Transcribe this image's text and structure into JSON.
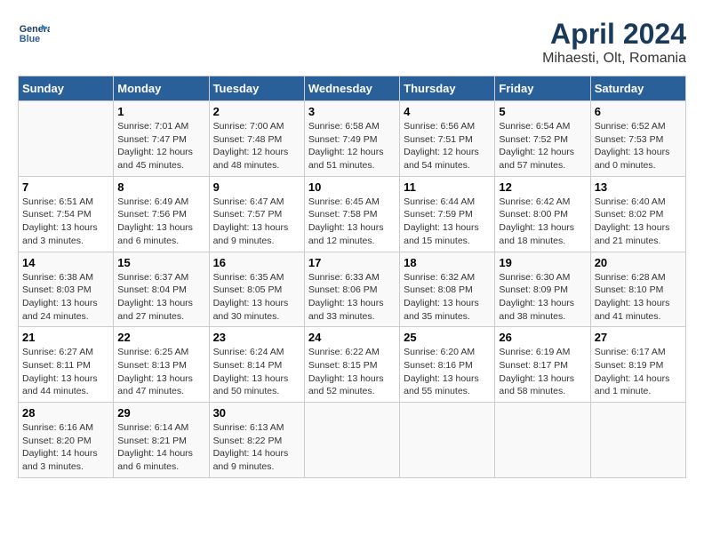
{
  "header": {
    "logo_line1": "General",
    "logo_line2": "Blue",
    "title": "April 2024",
    "subtitle": "Mihaesti, Olt, Romania"
  },
  "days_of_week": [
    "Sunday",
    "Monday",
    "Tuesday",
    "Wednesday",
    "Thursday",
    "Friday",
    "Saturday"
  ],
  "weeks": [
    [
      {
        "day": "",
        "info": ""
      },
      {
        "day": "1",
        "info": "Sunrise: 7:01 AM\nSunset: 7:47 PM\nDaylight: 12 hours\nand 45 minutes."
      },
      {
        "day": "2",
        "info": "Sunrise: 7:00 AM\nSunset: 7:48 PM\nDaylight: 12 hours\nand 48 minutes."
      },
      {
        "day": "3",
        "info": "Sunrise: 6:58 AM\nSunset: 7:49 PM\nDaylight: 12 hours\nand 51 minutes."
      },
      {
        "day": "4",
        "info": "Sunrise: 6:56 AM\nSunset: 7:51 PM\nDaylight: 12 hours\nand 54 minutes."
      },
      {
        "day": "5",
        "info": "Sunrise: 6:54 AM\nSunset: 7:52 PM\nDaylight: 12 hours\nand 57 minutes."
      },
      {
        "day": "6",
        "info": "Sunrise: 6:52 AM\nSunset: 7:53 PM\nDaylight: 13 hours\nand 0 minutes."
      }
    ],
    [
      {
        "day": "7",
        "info": "Sunrise: 6:51 AM\nSunset: 7:54 PM\nDaylight: 13 hours\nand 3 minutes."
      },
      {
        "day": "8",
        "info": "Sunrise: 6:49 AM\nSunset: 7:56 PM\nDaylight: 13 hours\nand 6 minutes."
      },
      {
        "day": "9",
        "info": "Sunrise: 6:47 AM\nSunset: 7:57 PM\nDaylight: 13 hours\nand 9 minutes."
      },
      {
        "day": "10",
        "info": "Sunrise: 6:45 AM\nSunset: 7:58 PM\nDaylight: 13 hours\nand 12 minutes."
      },
      {
        "day": "11",
        "info": "Sunrise: 6:44 AM\nSunset: 7:59 PM\nDaylight: 13 hours\nand 15 minutes."
      },
      {
        "day": "12",
        "info": "Sunrise: 6:42 AM\nSunset: 8:00 PM\nDaylight: 13 hours\nand 18 minutes."
      },
      {
        "day": "13",
        "info": "Sunrise: 6:40 AM\nSunset: 8:02 PM\nDaylight: 13 hours\nand 21 minutes."
      }
    ],
    [
      {
        "day": "14",
        "info": "Sunrise: 6:38 AM\nSunset: 8:03 PM\nDaylight: 13 hours\nand 24 minutes."
      },
      {
        "day": "15",
        "info": "Sunrise: 6:37 AM\nSunset: 8:04 PM\nDaylight: 13 hours\nand 27 minutes."
      },
      {
        "day": "16",
        "info": "Sunrise: 6:35 AM\nSunset: 8:05 PM\nDaylight: 13 hours\nand 30 minutes."
      },
      {
        "day": "17",
        "info": "Sunrise: 6:33 AM\nSunset: 8:06 PM\nDaylight: 13 hours\nand 33 minutes."
      },
      {
        "day": "18",
        "info": "Sunrise: 6:32 AM\nSunset: 8:08 PM\nDaylight: 13 hours\nand 35 minutes."
      },
      {
        "day": "19",
        "info": "Sunrise: 6:30 AM\nSunset: 8:09 PM\nDaylight: 13 hours\nand 38 minutes."
      },
      {
        "day": "20",
        "info": "Sunrise: 6:28 AM\nSunset: 8:10 PM\nDaylight: 13 hours\nand 41 minutes."
      }
    ],
    [
      {
        "day": "21",
        "info": "Sunrise: 6:27 AM\nSunset: 8:11 PM\nDaylight: 13 hours\nand 44 minutes."
      },
      {
        "day": "22",
        "info": "Sunrise: 6:25 AM\nSunset: 8:13 PM\nDaylight: 13 hours\nand 47 minutes."
      },
      {
        "day": "23",
        "info": "Sunrise: 6:24 AM\nSunset: 8:14 PM\nDaylight: 13 hours\nand 50 minutes."
      },
      {
        "day": "24",
        "info": "Sunrise: 6:22 AM\nSunset: 8:15 PM\nDaylight: 13 hours\nand 52 minutes."
      },
      {
        "day": "25",
        "info": "Sunrise: 6:20 AM\nSunset: 8:16 PM\nDaylight: 13 hours\nand 55 minutes."
      },
      {
        "day": "26",
        "info": "Sunrise: 6:19 AM\nSunset: 8:17 PM\nDaylight: 13 hours\nand 58 minutes."
      },
      {
        "day": "27",
        "info": "Sunrise: 6:17 AM\nSunset: 8:19 PM\nDaylight: 14 hours\nand 1 minute."
      }
    ],
    [
      {
        "day": "28",
        "info": "Sunrise: 6:16 AM\nSunset: 8:20 PM\nDaylight: 14 hours\nand 3 minutes."
      },
      {
        "day": "29",
        "info": "Sunrise: 6:14 AM\nSunset: 8:21 PM\nDaylight: 14 hours\nand 6 minutes."
      },
      {
        "day": "30",
        "info": "Sunrise: 6:13 AM\nSunset: 8:22 PM\nDaylight: 14 hours\nand 9 minutes."
      },
      {
        "day": "",
        "info": ""
      },
      {
        "day": "",
        "info": ""
      },
      {
        "day": "",
        "info": ""
      },
      {
        "day": "",
        "info": ""
      }
    ]
  ]
}
